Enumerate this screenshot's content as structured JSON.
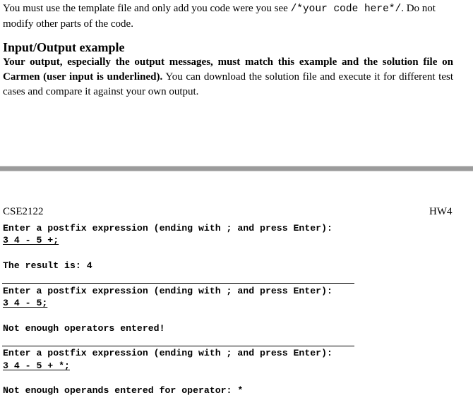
{
  "intro": {
    "text_before": "You must use the template file and only add you code were you see ",
    "code": "/*your code here*/",
    "text_after": ". Do not modify other parts of the code."
  },
  "io_section": {
    "heading": "Input/Output example",
    "bold_text": "Your output, especially the output messages, must match this example and the solution file on Carmen (user input is underlined).",
    "plain_text": " You can download the solution file and execute it for different test cases and compare it against your own output."
  },
  "example": {
    "course": "CSE2122",
    "assignment": "HW4",
    "runs": [
      {
        "prompt": "Enter a postfix expression (ending with ; and press Enter):",
        "input": "3 4 - 5 +;",
        "output": "The result is: 4"
      },
      {
        "prompt": "Enter a postfix expression (ending with ; and press Enter):",
        "input": "3 4 - 5;",
        "output": "Not enough operators entered!"
      },
      {
        "prompt": "Enter a postfix expression (ending with ; and press Enter):",
        "input": "3 4 - 5 + *;",
        "output": "Not enough operands entered for operator: *"
      }
    ]
  }
}
